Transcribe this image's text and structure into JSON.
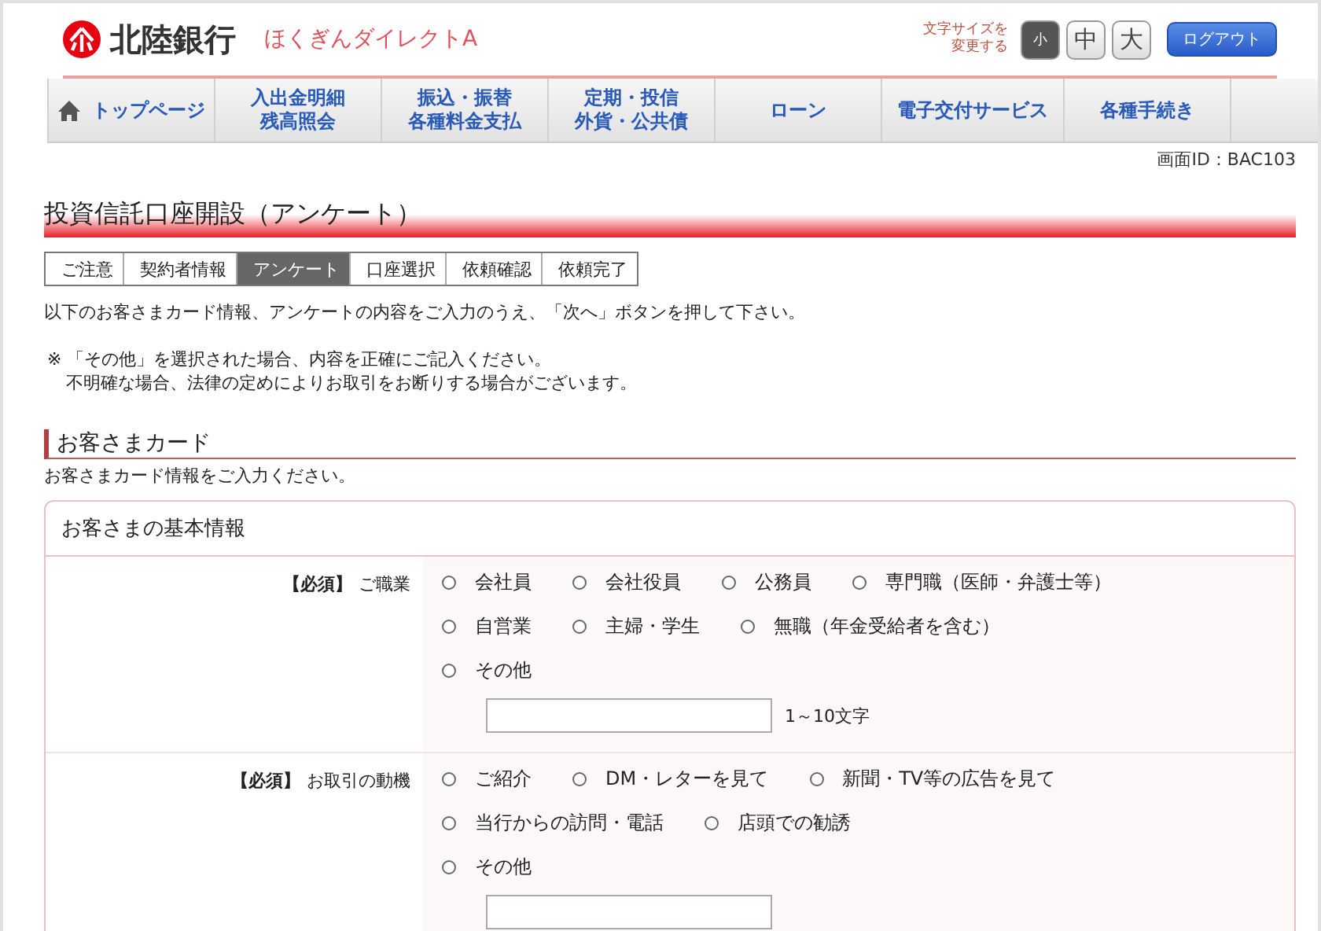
{
  "header": {
    "bank_name": "北陸銀行",
    "service_name": "ほくぎんダイレクトA",
    "font_size_label": [
      "文字サイズを",
      "変更する"
    ],
    "font_sizes": [
      {
        "label": "小",
        "selected": true
      },
      {
        "label": "中",
        "selected": false
      },
      {
        "label": "大",
        "selected": false
      }
    ],
    "logout": "ログアウト"
  },
  "nav": [
    {
      "lines": [
        "トップページ"
      ],
      "home": true
    },
    {
      "lines": [
        "入出金明細",
        "残高照会"
      ],
      "home": false
    },
    {
      "lines": [
        "振込・振替",
        "各種料金支払"
      ],
      "home": false
    },
    {
      "lines": [
        "定期・投信",
        "外貨・公共債"
      ],
      "home": false
    },
    {
      "lines": [
        "ローン"
      ],
      "home": false
    },
    {
      "lines": [
        "電子交付サービス"
      ],
      "home": false
    },
    {
      "lines": [
        "各種手続き"
      ],
      "home": false
    }
  ],
  "screen_id": "画面ID：BAC103",
  "title": "投資信託口座開設（アンケート）",
  "steps": [
    {
      "label": "ご注意",
      "selected": false
    },
    {
      "label": "契約者情報",
      "selected": false
    },
    {
      "label": "アンケート",
      "selected": true
    },
    {
      "label": "口座選択",
      "selected": false
    },
    {
      "label": "依頼確認",
      "selected": false
    },
    {
      "label": "依頼完了",
      "selected": false
    }
  ],
  "intro": "以下のお客さまカード情報、アンケートの内容をご入力のうえ、「次へ」ボタンを押して下さい。",
  "notes": [
    "※ 「その他」を選択された場合、内容を正確にご記入ください。",
    "不明確な場合、法律の定めによりお取引をお断りする場合がございます。"
  ],
  "section": {
    "title": "お客さまカード",
    "description": "お客さまカード情報をご入力ください。"
  },
  "panel": {
    "title": "お客さまの基本情報",
    "questions": [
      {
        "required": "【必須】",
        "label": "ご職業",
        "rows": [
          [
            {
              "label": "会社員",
              "selected": false
            },
            {
              "label": "会社役員",
              "selected": false
            },
            {
              "label": "公務員",
              "selected": false
            },
            {
              "label": "専門職（医師・弁護士等）",
              "selected": false
            }
          ],
          [
            {
              "label": "自営業",
              "selected": false
            },
            {
              "label": "主婦・学生",
              "selected": false
            },
            {
              "label": "無職（年金受給者を含む）",
              "selected": false
            }
          ],
          [
            {
              "label": "その他",
              "selected": false
            }
          ]
        ],
        "hint": "1～10文字"
      },
      {
        "required": "【必須】",
        "label": "お取引の動機",
        "rows": [
          [
            {
              "label": "ご紹介",
              "selected": false
            },
            {
              "label": "DM・レターを見て",
              "selected": false
            },
            {
              "label": "新聞・TV等の広告を見て",
              "selected": false
            }
          ],
          [
            {
              "label": "当行からの訪問・電話",
              "selected": false
            },
            {
              "label": "店頭での勧誘",
              "selected": false
            }
          ],
          [
            {
              "label": "その他",
              "selected": false
            }
          ]
        ]
      }
    ]
  }
}
